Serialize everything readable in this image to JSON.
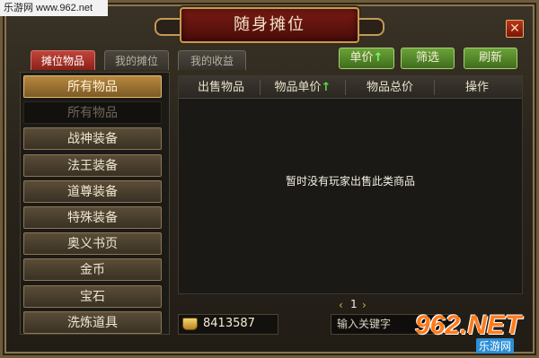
{
  "watermark": "乐游网 www.962.net",
  "window": {
    "title": "随身摊位",
    "close_icon": "close-icon"
  },
  "tabs": [
    {
      "label": "摊位物品",
      "active": true
    },
    {
      "label": "我的摊位",
      "active": false
    },
    {
      "label": "我的收益",
      "active": false
    }
  ],
  "toolbar": {
    "sort_label": "单价",
    "sort_arrow": "↑",
    "filter_label": "筛选",
    "refresh_label": "刷新"
  },
  "categories": [
    {
      "label": "所有物品",
      "state": "selected"
    },
    {
      "label": "所有物品",
      "state": "sub"
    },
    {
      "label": "战神装备",
      "state": "normal"
    },
    {
      "label": "法王装备",
      "state": "normal"
    },
    {
      "label": "道尊装备",
      "state": "normal"
    },
    {
      "label": "特殊装备",
      "state": "normal"
    },
    {
      "label": "奥义书页",
      "state": "normal"
    },
    {
      "label": "金币",
      "state": "normal"
    },
    {
      "label": "宝石",
      "state": "normal"
    },
    {
      "label": "洗炼道具",
      "state": "normal"
    }
  ],
  "table": {
    "columns": [
      "出售物品",
      "物品单价",
      "物品总价",
      "操作"
    ],
    "sort_arrow": "↑",
    "empty_message": "暂时没有玩家出售此类商品"
  },
  "pager": {
    "prev": "‹",
    "page": "1",
    "next": "›"
  },
  "wallet": {
    "gold": "8413587"
  },
  "search": {
    "placeholder": "输入关键字"
  },
  "logo": {
    "brand": "962.NET",
    "sub": "乐游网"
  },
  "colors": {
    "accent_green": "#6ba23a",
    "tab_red": "#c1443a",
    "gold": "#b6883f"
  }
}
